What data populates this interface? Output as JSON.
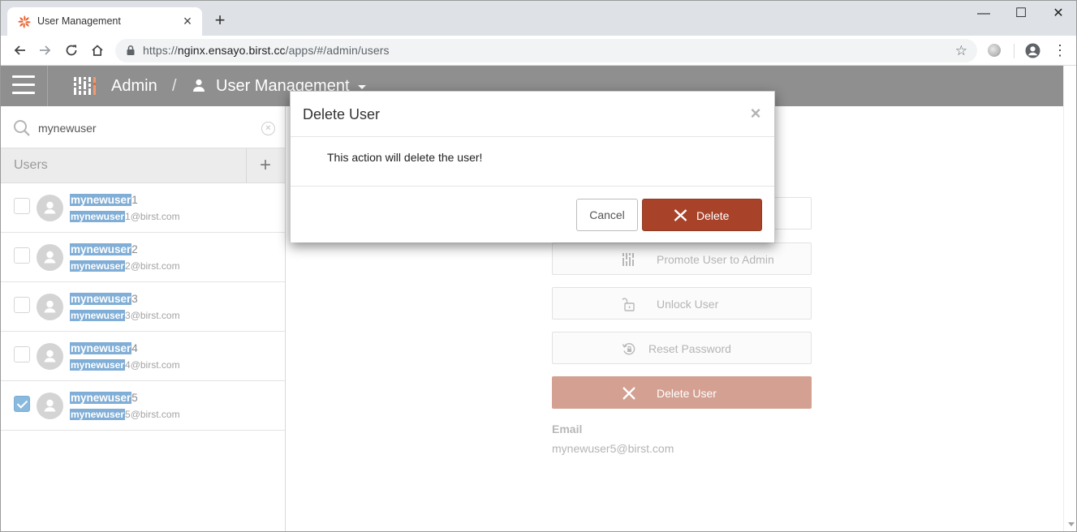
{
  "browser": {
    "tab_title": "User Management",
    "new_tab_symbol": "+",
    "url_scheme": "https://",
    "url_host": "nginx.ensayo.birst.cc",
    "url_path": "/apps/#/admin/users",
    "window_controls": {
      "minimize": "—",
      "maximize": "☐",
      "close": "✕"
    }
  },
  "header": {
    "section": "Admin",
    "separator": "/",
    "page": "User Management"
  },
  "sidebar": {
    "search": {
      "value": "mynewuser",
      "placeholder": ""
    },
    "users_title": "Users",
    "add_symbol": "+",
    "users": [
      {
        "name_match": "mynewuser",
        "name_rest": "1",
        "email_match": "mynewuser",
        "email_rest": "1@birst.com",
        "checked": false
      },
      {
        "name_match": "mynewuser",
        "name_rest": "2",
        "email_match": "mynewuser",
        "email_rest": "2@birst.com",
        "checked": false
      },
      {
        "name_match": "mynewuser",
        "name_rest": "3",
        "email_match": "mynewuser",
        "email_rest": "3@birst.com",
        "checked": false
      },
      {
        "name_match": "mynewuser",
        "name_rest": "4",
        "email_match": "mynewuser",
        "email_rest": "4@birst.com",
        "checked": false
      },
      {
        "name_match": "mynewuser",
        "name_rest": "5",
        "email_match": "mynewuser",
        "email_rest": "5@birst.com",
        "checked": true
      }
    ]
  },
  "details": {
    "actions": {
      "promote": "Promote User to Admin",
      "unlock": "Unlock User",
      "reset": "Reset Password",
      "delete": "Delete User"
    },
    "email_label": "Email",
    "email_value": "mynewuser5@birst.com"
  },
  "modal": {
    "title": "Delete User",
    "close_symbol": "×",
    "message": "This action will delete the user!",
    "cancel_label": "Cancel",
    "delete_label": "Delete"
  },
  "colors": {
    "header_bg": "#8f8f8f",
    "highlight": "#80aed6",
    "danger": "#a84329",
    "danger_faded": "#d3a092"
  }
}
